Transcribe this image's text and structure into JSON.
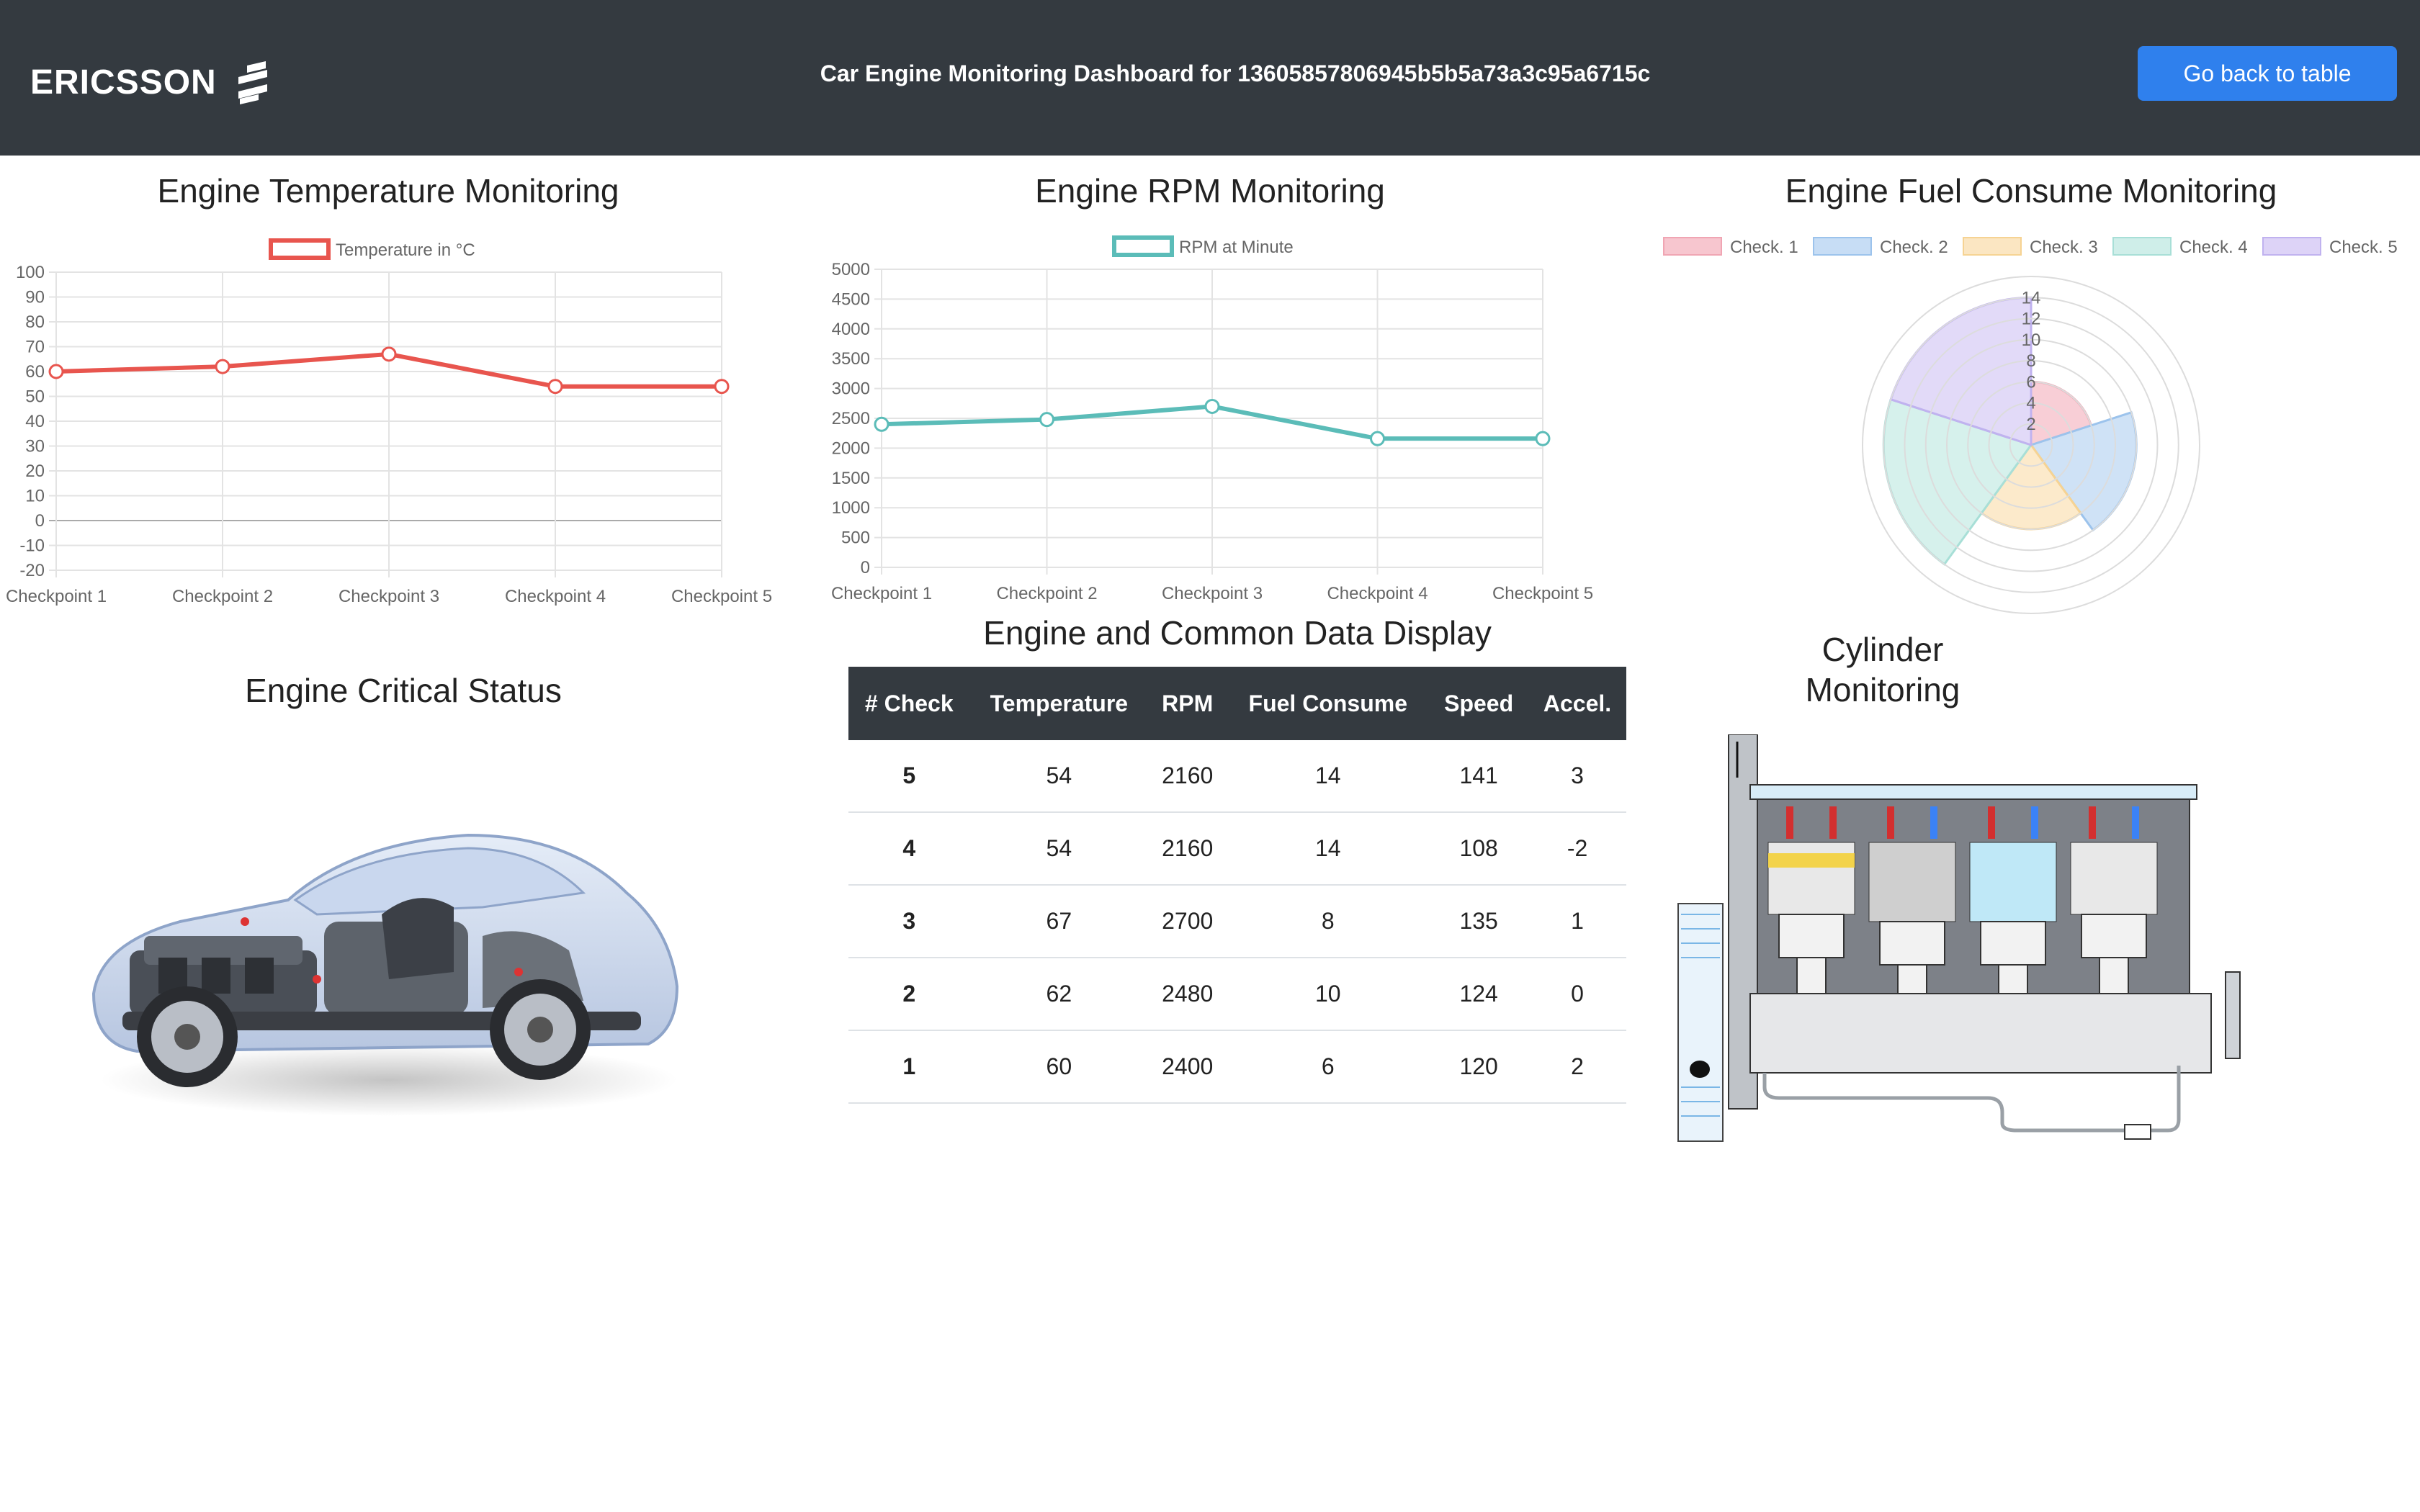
{
  "header": {
    "logo_text": "ERICSSON",
    "title": "Car Engine Monitoring Dashboard for 13605857806945b5b5a73a3c95a6715c",
    "back_button": "Go back to table"
  },
  "panels": {
    "temperature_title": "Engine Temperature Monitoring",
    "rpm_title": "Engine RPM Monitoring",
    "fuel_title": "Engine Fuel Consume Monitoring",
    "critical_title": "Engine Critical Status",
    "table_title": "Engine and Common Data Display",
    "cylinder_title_line1": "Cylinder",
    "cylinder_title_line2": "Monitoring"
  },
  "chart_data": [
    {
      "type": "line",
      "title": "Engine Temperature Monitoring",
      "categories": [
        "Checkpoint 1",
        "Checkpoint 2",
        "Checkpoint 3",
        "Checkpoint 4",
        "Checkpoint 5"
      ],
      "series": [
        {
          "name": "Temperature in °C",
          "values": [
            60,
            62,
            67,
            54,
            54
          ],
          "color": "#e8554e"
        }
      ],
      "ylim": [
        -20,
        100
      ],
      "yticks": [
        100,
        90,
        80,
        70,
        60,
        50,
        40,
        30,
        20,
        10,
        0,
        -10,
        -20
      ],
      "legend": "top",
      "grid": true
    },
    {
      "type": "line",
      "title": "Engine RPM Monitoring",
      "categories": [
        "Checkpoint 1",
        "Checkpoint 2",
        "Checkpoint 3",
        "Checkpoint 4",
        "Checkpoint 5"
      ],
      "series": [
        {
          "name": "RPM at Minute",
          "values": [
            2400,
            2480,
            2700,
            2160,
            2160
          ],
          "color": "#5bbcb8"
        }
      ],
      "ylim": [
        0,
        5000
      ],
      "yticks": [
        5000,
        4500,
        4000,
        3500,
        3000,
        2500,
        2000,
        1500,
        1000,
        500,
        0
      ],
      "legend": "top",
      "grid": true
    },
    {
      "type": "polarArea",
      "title": "Engine Fuel Consume Monitoring",
      "categories": [
        "Check. 1",
        "Check. 2",
        "Check. 3",
        "Check. 4",
        "Check. 5"
      ],
      "values": [
        6,
        10,
        8,
        14,
        14
      ],
      "colors": [
        "#f7c6cf",
        "#c7ddf5",
        "#fbe6c2",
        "#cfeee9",
        "#ddd3f7"
      ],
      "border_colors": [
        "#f0a5b3",
        "#9cc3ec",
        "#f6d393",
        "#a8dfd7",
        "#c0b2ef"
      ],
      "rticks": [
        14,
        12,
        10,
        8,
        6,
        4,
        2
      ],
      "rmax": 16,
      "legend": "top"
    }
  ],
  "table": {
    "headers": [
      "# Check",
      "Temperature",
      "RPM",
      "Fuel Consume",
      "Speed",
      "Accel."
    ],
    "rows": [
      [
        "5",
        "54",
        "2160",
        "14",
        "141",
        "3"
      ],
      [
        "4",
        "54",
        "2160",
        "14",
        "108",
        "-2"
      ],
      [
        "3",
        "67",
        "2700",
        "8",
        "135",
        "1"
      ],
      [
        "2",
        "62",
        "2480",
        "10",
        "124",
        "0"
      ],
      [
        "1",
        "60",
        "2400",
        "6",
        "120",
        "2"
      ]
    ]
  }
}
